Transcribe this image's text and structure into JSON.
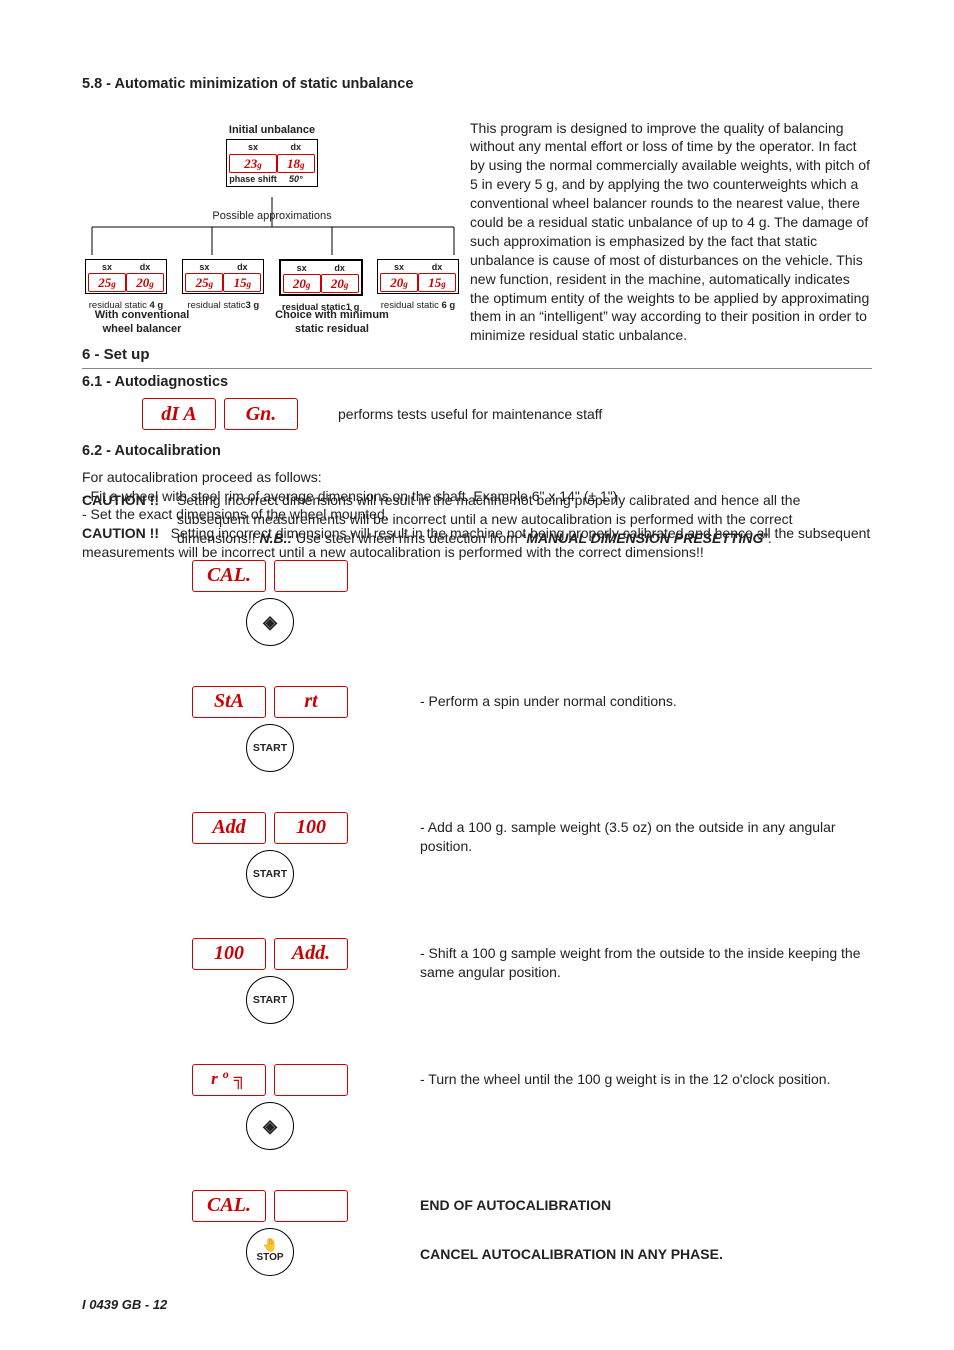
{
  "s58_title": "5.8 - Automatic minimization of static unbalance",
  "s58_text": "This program is designed to improve the quality of balancing without any mental effort or loss of time by the operator. In fact by using the normal commercially available weights, with pitch of 5 in every 5 g, and by applying the two counterweights which a conventional wheel balancer rounds to the nearest value, there could be a residual static unbalance of up to 4 g. The damage of such approximation is emphasized by the fact that static unbalance is cause of most of disturbances on the vehicle. This new function, resident in the machine, automatically indicates the optimum entity of the weights to be applied by approximating them in an “intelligent” way according to their position in order to minimize residual static unbalance.",
  "diagram": {
    "initial_label": "Initial unbalance",
    "sx": "sx",
    "dx": "dx",
    "init_sx": "23",
    "init_dx": "18",
    "phase_label": "phase shift",
    "phase_val": "50°",
    "approx_label": "Possible approximations",
    "blocks": [
      {
        "sx": "25",
        "dx": "20",
        "resid": "residual static",
        "g": "4 g",
        "hi": false
      },
      {
        "sx": "25",
        "dx": "15",
        "resid": "residual static",
        "g": "3 g",
        "hi": false
      },
      {
        "sx": "20",
        "dx": "20",
        "resid": "residual static",
        "g": "1 g",
        "hi": true
      },
      {
        "sx": "20",
        "dx": "15",
        "resid": "residual static",
        "g": "6 g",
        "hi": false
      }
    ],
    "left_caption_l1": "With conventional",
    "left_caption_l2": "wheel balancer",
    "right_caption_l1": "Choice with minimum",
    "right_caption_l2": "static residual"
  },
  "s6_title": "6 - Set up",
  "s61_title": "6.1 - Autodiagnostics",
  "s61_disp_l": "dI A",
  "s61_disp_r": "Gn.",
  "s61_text": "performs tests useful for maintenance staff",
  "s62_title": "6.2 - Autocalibration",
  "s62_p1": "For autocalibration proceed as follows:",
  "s62_p2": "- Fit a wheel with steel rim of average dimensions on the shaft. Example 6\" x 14\" (± 1\")",
  "s62_p3": "- Set the exact dimensions of the wheel mounted.",
  "caution_label": "CAUTION !!",
  "caution_text_1": "Setting incorrect dimensions will result in the machine not being properly  calibrated and hence all the subsequent measurements  will be incorrect until a new autocalibration is performed with the correct dimensions!! ",
  "nb_label": "N.B.:",
  "caution_text_2": " Use steel wheel rims detection from “",
  "manual_preset": "MANUAL DIMENSION PRESETTING",
  "caution_text_3": "”.",
  "steps": [
    {
      "l": "CAL.",
      "r": "",
      "btn": "diamond",
      "text": ""
    },
    {
      "l": "StA",
      "r": "rt",
      "btn": "START",
      "text": "- Perform a spin under normal conditions."
    },
    {
      "l": "Add",
      "r": "100",
      "btn": "START",
      "text": "- Add a 100 g. sample weight (3.5 oz) on the outside in any angular position."
    },
    {
      "l": "100",
      "r": "Add.",
      "btn": "START",
      "text": "- Shift a 100 g sample weight from the outside to the inside keeping the same angular position."
    },
    {
      "l": "r o ╗",
      "r": "",
      "btn": "diamond",
      "text": "- Turn the wheel until the 100 g weight is in the 12 o'clock position."
    },
    {
      "l": "CAL.",
      "r": "",
      "btn": "STOP",
      "text_bold": "END OF AUTOCALIBRATION",
      "text_bold2": "CANCEL AUTOCALIBRATION IN ANY PHASE."
    }
  ],
  "footer_code": "I  0439  GB - ",
  "footer_page": "12"
}
